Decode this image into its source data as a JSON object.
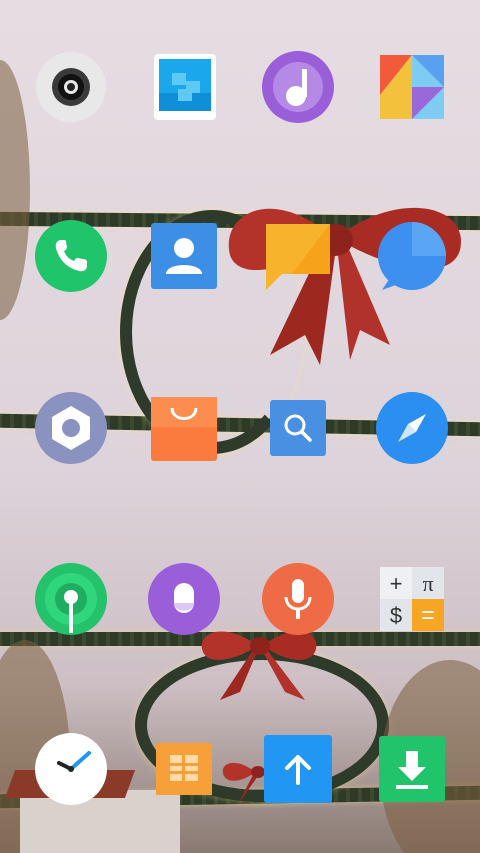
{
  "screen": {
    "background": "christmas-garland-wallpaper",
    "accent_colors": {
      "garland": "#2f3b2a",
      "bow": "#b02c24",
      "sky": "#e2d8de"
    }
  },
  "home_grid": {
    "rows": [
      [
        {
          "icon": "camera-icon",
          "color": "#e6e6e6"
        },
        {
          "icon": "gallery-icon",
          "color": "#23a6e8"
        },
        {
          "icon": "music-icon",
          "color": "#9a5ed8"
        },
        {
          "icon": "themes-icon",
          "color": "#f4a53c"
        }
      ],
      [
        {
          "icon": "phone-icon",
          "color": "#1fc46b"
        },
        {
          "icon": "contacts-icon",
          "color": "#3d8fe6"
        },
        {
          "icon": "notes-icon",
          "color": "#f7b32b"
        },
        {
          "icon": "messaging-icon",
          "color": "#3d8ff0"
        }
      ],
      [
        {
          "icon": "settings-icon",
          "color": "#8a93bf"
        },
        {
          "icon": "app-store-icon",
          "color": "#fb7a3d"
        },
        {
          "icon": "search-app-icon",
          "color": "#4a90e2"
        },
        {
          "icon": "browser-compass-icon",
          "color": "#2a8ff0"
        }
      ],
      [
        {
          "icon": "hotspot-icon",
          "color": "#23c26b"
        },
        {
          "icon": "voice-assistant-icon",
          "color": "#9a5ed8"
        },
        {
          "icon": "voice-recorder-icon",
          "color": "#ee6b45"
        },
        {
          "icon": "calculator-icon",
          "color": "#f6a623"
        }
      ],
      [
        {
          "icon": "clock-icon",
          "color": "#ffffff"
        },
        {
          "icon": "file-manager-icon",
          "color": "#f7a03a"
        },
        {
          "icon": "updater-icon",
          "color": "#2196f3"
        },
        {
          "icon": "downloads-icon",
          "color": "#21c46b"
        }
      ]
    ]
  },
  "calculator_symbols": {
    "plus": "+",
    "pi": "π",
    "dollar": "$",
    "equals": "="
  }
}
